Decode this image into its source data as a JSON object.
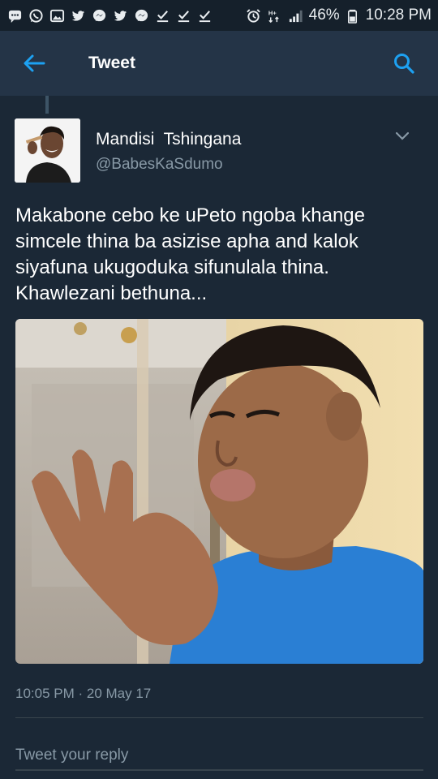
{
  "status_bar": {
    "icons": [
      "chat-icon",
      "whatsapp-icon",
      "gallery-icon",
      "twitter-icon",
      "messenger-icon",
      "twitter-icon",
      "messenger-icon",
      "download-done-icon",
      "download-done-icon",
      "download-done-icon",
      "alarm-icon",
      "network-hplus-icon",
      "signal-icon",
      "battery-icon"
    ],
    "network": "H+",
    "battery": "46%",
    "time": "10:28 PM"
  },
  "app_bar": {
    "title": "Tweet",
    "back_icon": "arrow-left-icon",
    "search_icon": "search-icon"
  },
  "tweet": {
    "display_name": "Mandisi  Tshingana",
    "handle": "@BabesKaSdumo",
    "text_lines": [
      "Makabone cebo ke uPeto ngoba khange",
      "simcele thina ba asizise apha and kalok",
      "siyafuna ukugoduka sifunulala thina.",
      "Khawlezani bethuna..."
    ],
    "timestamp": "10:05 PM · 20 May 17"
  },
  "reply": {
    "placeholder": "Tweet your reply"
  },
  "colors": {
    "background": "#1b2836",
    "app_bar": "#243447",
    "status_bar": "#15202b",
    "accent": "#1da1f2",
    "secondary_text": "#8899a6"
  }
}
